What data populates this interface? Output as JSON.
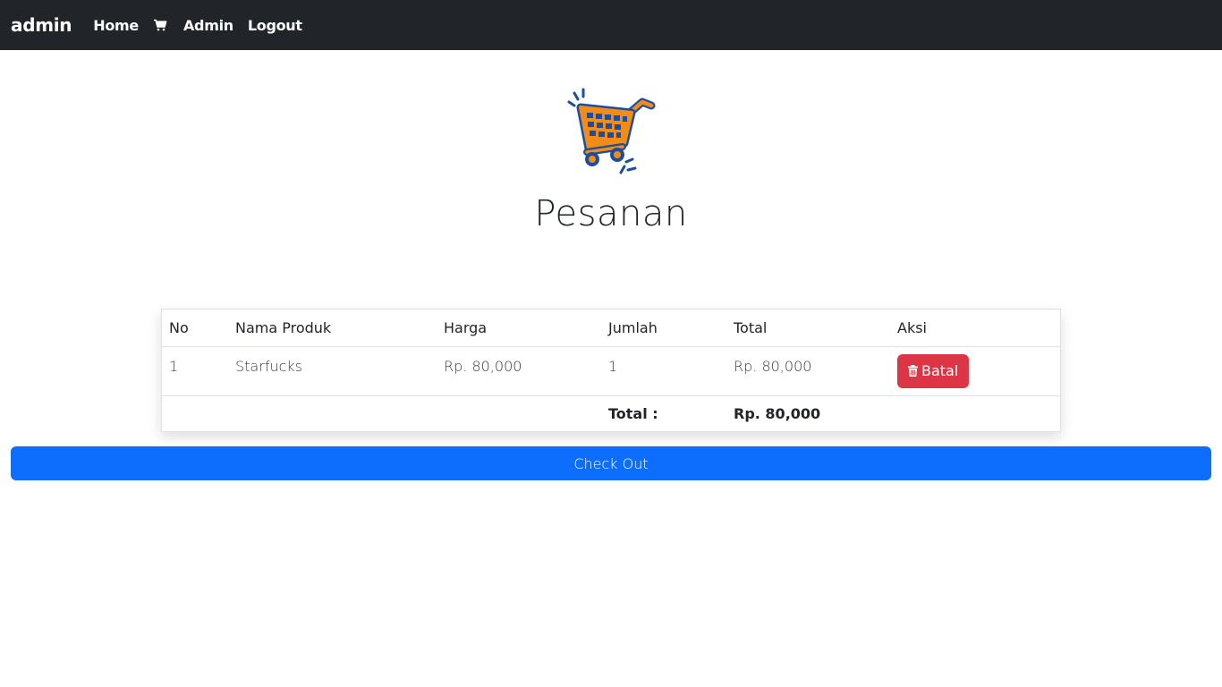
{
  "navbar": {
    "brand": "admin",
    "links": [
      {
        "label": "Home"
      },
      {
        "label": "Admin"
      },
      {
        "label": "Logout"
      }
    ],
    "cart_icon": "cart-icon"
  },
  "hero": {
    "illustration": "shopping-cart-illustration",
    "title": "Pesanan"
  },
  "table": {
    "headers": [
      "No",
      "Nama Produk",
      "Harga",
      "Jumlah",
      "Total",
      "Aksi"
    ],
    "rows": [
      {
        "no": "1",
        "nama_produk": "Starfucks",
        "harga": "Rp. 80,000",
        "jumlah": "1",
        "total": "Rp. 80,000",
        "aksi_label": "Batal"
      }
    ],
    "total_label": "Total :",
    "total_value": "Rp. 80,000"
  },
  "checkout": {
    "label": "Check Out"
  },
  "colors": {
    "navbar_bg": "#212529",
    "danger": "#dc3545",
    "primary": "#0d6efd",
    "cart_orange": "#f28c18",
    "cart_blue": "#1d4e9e"
  }
}
